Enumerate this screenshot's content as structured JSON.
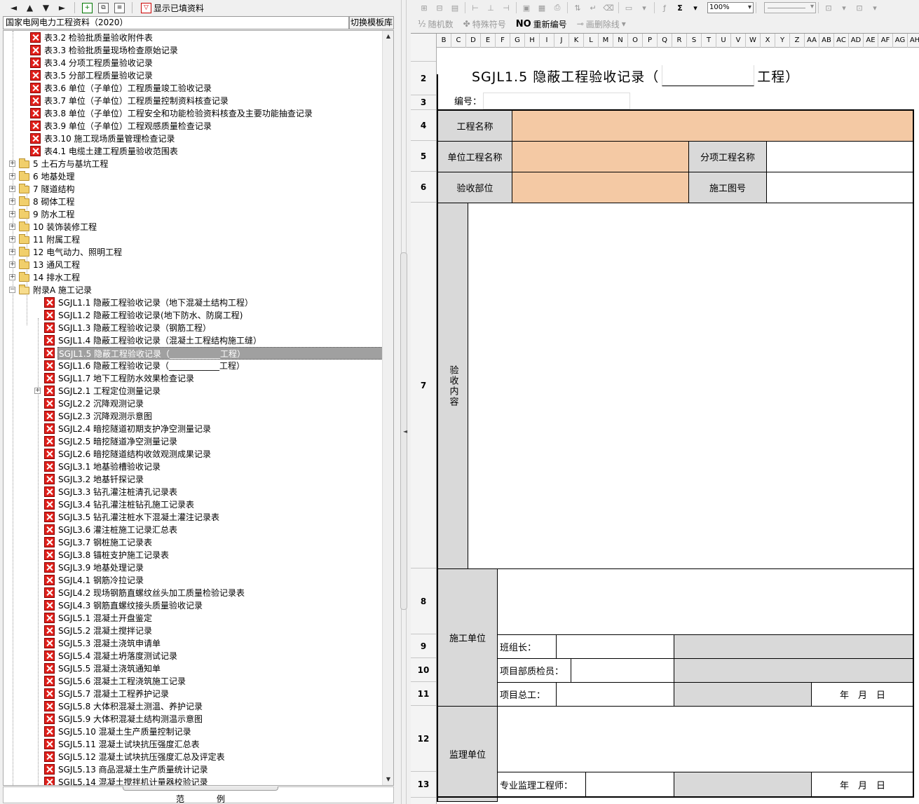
{
  "left_toolbar": {
    "filter_label": "显示已填资料"
  },
  "template": {
    "current": "国家电网电力工程资料（2020）",
    "switch_label": "切换模板库"
  },
  "tree": [
    {
      "level": 2,
      "icon": "x",
      "label": "表3.2 检验批质量验收附件表"
    },
    {
      "level": 2,
      "icon": "x",
      "label": "表3.3 检验批质量现场检查原始记录"
    },
    {
      "level": 2,
      "icon": "x",
      "label": "表3.4 分项工程质量验收记录"
    },
    {
      "level": 2,
      "icon": "x",
      "label": "表3.5 分部工程质量验收记录"
    },
    {
      "level": 2,
      "icon": "x",
      "label": "表3.6 单位（子单位）工程质量竣工验收记录"
    },
    {
      "level": 2,
      "icon": "x",
      "label": "表3.7 单位（子单位）工程质量控制资料核查记录"
    },
    {
      "level": 2,
      "icon": "x",
      "label": "表3.8 单位（子单位）工程安全和功能检验资料核查及主要功能抽查记录"
    },
    {
      "level": 2,
      "icon": "x",
      "label": "表3.9 单位（子单位）工程观感质量检查记录"
    },
    {
      "level": 2,
      "icon": "x",
      "label": "表3.10 施工现场质量管理检查记录"
    },
    {
      "level": 2,
      "icon": "x",
      "label": "表4.1 电缆土建工程质量验收范围表"
    },
    {
      "level": 1,
      "icon": "folder",
      "exp": "+",
      "label": "5 土石方与基坑工程"
    },
    {
      "level": 1,
      "icon": "folder",
      "exp": "+",
      "label": "6 地基处理"
    },
    {
      "level": 1,
      "icon": "folder",
      "exp": "+",
      "label": "7 隧道结构"
    },
    {
      "level": 1,
      "icon": "folder",
      "exp": "+",
      "label": "8 砌体工程"
    },
    {
      "level": 1,
      "icon": "folder",
      "exp": "+",
      "label": "9 防水工程"
    },
    {
      "level": 1,
      "icon": "folder",
      "exp": "+",
      "label": "10 装饰装修工程"
    },
    {
      "level": 1,
      "icon": "folder",
      "exp": "+",
      "label": "11 附属工程"
    },
    {
      "level": 1,
      "icon": "folder",
      "exp": "+",
      "label": "12 电气动力、照明工程"
    },
    {
      "level": 1,
      "icon": "folder",
      "exp": "+",
      "label": "13 通风工程"
    },
    {
      "level": 1,
      "icon": "folder",
      "exp": "+",
      "label": "14 排水工程"
    },
    {
      "level": 1,
      "icon": "folder-open",
      "exp": "−",
      "label": "附录A 施工记录"
    },
    {
      "level": 3,
      "icon": "x",
      "label": "SGJL1.1 隐蔽工程验收记录（地下混凝土结构工程）"
    },
    {
      "level": 3,
      "icon": "x",
      "label": "SGJL1.2 隐蔽工程验收记录(地下防水、防腐工程)"
    },
    {
      "level": 3,
      "icon": "x",
      "label": "SGJL1.3 隐蔽工程验收记录（钢筋工程）"
    },
    {
      "level": 3,
      "icon": "x",
      "label": "SGJL1.4 隐蔽工程验收记录（混凝土工程结构施工缝）"
    },
    {
      "level": 3,
      "icon": "x",
      "label": "SGJL1.5 隐蔽工程验收记录（____________工程）",
      "selected": true
    },
    {
      "level": 3,
      "icon": "x",
      "label": "SGJL1.6 隐蔽工程验收记录（____________工程）"
    },
    {
      "level": 3,
      "icon": "x",
      "label": "SGJL1.7 地下工程防水效果检查记录"
    },
    {
      "level": 3,
      "icon": "x",
      "exp": "+",
      "label": "SGJL2.1 工程定位测量记录"
    },
    {
      "level": 3,
      "icon": "x",
      "label": "SGJL2.2 沉降观测记录"
    },
    {
      "level": 3,
      "icon": "x",
      "label": "SGJL2.3 沉降观测示意图"
    },
    {
      "level": 3,
      "icon": "x",
      "label": "SGJL2.4 暗挖隧道初期支护净空测量记录"
    },
    {
      "level": 3,
      "icon": "x",
      "label": "SGJL2.5 暗挖隧道净空测量记录"
    },
    {
      "level": 3,
      "icon": "x",
      "label": "SGJL2.6 暗挖隧道结构收敛观测成果记录"
    },
    {
      "level": 3,
      "icon": "x",
      "label": "SGJL3.1 地基验槽验收记录"
    },
    {
      "level": 3,
      "icon": "x",
      "label": "SGJL3.2 地基钎探记录"
    },
    {
      "level": 3,
      "icon": "x",
      "label": "SGJL3.3 钻孔灌注桩清孔记录表"
    },
    {
      "level": 3,
      "icon": "x",
      "label": "SGJL3.4 钻孔灌注桩钻孔施工记录表"
    },
    {
      "level": 3,
      "icon": "x",
      "label": "SGJL3.5 钻孔灌注桩水下混凝土灌注记录表"
    },
    {
      "level": 3,
      "icon": "x",
      "label": "SGJL3.6 灌注桩施工记录汇总表"
    },
    {
      "level": 3,
      "icon": "x",
      "label": "SGJL3.7 钢桩施工记录表"
    },
    {
      "level": 3,
      "icon": "x",
      "label": "SGJL3.8 锚桩支护施工记录表"
    },
    {
      "level": 3,
      "icon": "x",
      "label": "SGJL3.9 地基处理记录"
    },
    {
      "level": 3,
      "icon": "x",
      "label": "SGJL4.1 钢筋冷拉记录"
    },
    {
      "level": 3,
      "icon": "x",
      "label": "SGJL4.2 现场钢筋直螺纹丝头加工质量检验记录表"
    },
    {
      "level": 3,
      "icon": "x",
      "label": "SGJL4.3 钢筋直螺纹接头质量验收记录"
    },
    {
      "level": 3,
      "icon": "x",
      "label": "SGJL5.1 混凝土开盘鉴定"
    },
    {
      "level": 3,
      "icon": "x",
      "label": "SGJL5.2 混凝土搅拌记录"
    },
    {
      "level": 3,
      "icon": "x",
      "label": "SGJL5.3 混凝土浇筑申请单"
    },
    {
      "level": 3,
      "icon": "x",
      "label": "SGJL5.4 混凝土坍落度测试记录"
    },
    {
      "level": 3,
      "icon": "x",
      "label": "SGJL5.5 混凝土浇筑通知单"
    },
    {
      "level": 3,
      "icon": "x",
      "label": "SGJL5.6 混凝土工程浇筑施工记录"
    },
    {
      "level": 3,
      "icon": "x",
      "label": "SGJL5.7 混凝土工程养护记录"
    },
    {
      "level": 3,
      "icon": "x",
      "label": "SGJL5.8 大体积混凝土测温、养护记录"
    },
    {
      "level": 3,
      "icon": "x",
      "label": "SGJL5.9 大体积混凝土结构测温示意图"
    },
    {
      "level": 3,
      "icon": "x",
      "label": "SGJL5.10 混凝土生产质量控制记录"
    },
    {
      "level": 3,
      "icon": "x",
      "label": "SGJL5.11 混凝土试块抗压强度汇总表"
    },
    {
      "level": 3,
      "icon": "x",
      "label": "SGJL5.12 混凝土试块抗压强度汇总及评定表"
    },
    {
      "level": 3,
      "icon": "x",
      "label": "SGJL5.13 商品混凝土生产质量统计记录"
    },
    {
      "level": 3,
      "icon": "x",
      "label": "SGJL5.14 混凝土搅拌机计量器校验记录"
    }
  ],
  "legend": {
    "label": "范例"
  },
  "right_toolbar": {
    "zoom": "100%",
    "random_label": "随机数",
    "special_label": "特殊符号",
    "no_label": "NO",
    "renumber_label": "重新编号",
    "strike_label": "画删除线"
  },
  "columns": [
    "B",
    "C",
    "D",
    "E",
    "F",
    "G",
    "H",
    "I",
    "J",
    "K",
    "L",
    "M",
    "N",
    "O",
    "P",
    "Q",
    "R",
    "S",
    "T",
    "U",
    "V",
    "W",
    "X",
    "Y",
    "Z",
    "AA",
    "AB",
    "AC",
    "AD",
    "AE",
    "AF",
    "AG",
    "AH"
  ],
  "rows": [
    "2",
    "3",
    "4",
    "5",
    "6",
    "7",
    "8",
    "9",
    "10",
    "11",
    "12",
    "13"
  ],
  "form": {
    "title_prefix": "SGJL1.5 隐蔽工程验收记录（",
    "title_suffix": "工程）",
    "number_label": "编号：",
    "project_name_label": "工程名称",
    "unit_project_label": "单位工程名称",
    "sub_project_label": "分项工程名称",
    "accept_part_label": "验收部位",
    "drawing_no_label": "施工图号",
    "content_label": "验收内容",
    "construction_unit_label": "施工单位",
    "team_leader_label": "班组长：",
    "dept_inspector_label": "项目部质检员：",
    "chief_engineer_label": "项目总工：",
    "date_label_1": "年　月　日",
    "supervision_unit_label": "监理单位",
    "supervisor_label": "专业监理工程师：",
    "date_label_2": "年　月　日"
  }
}
